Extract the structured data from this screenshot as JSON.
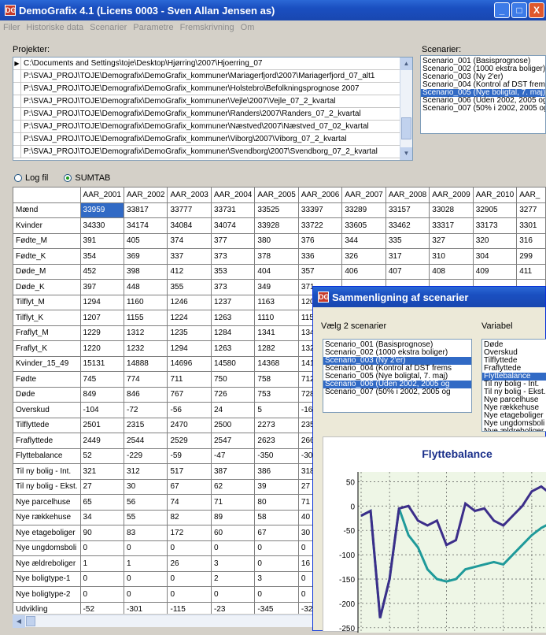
{
  "window": {
    "title": "DemoGrafix 4.1 (Licens 0003 - Sven Allan Jensen as)",
    "min": "_",
    "max": "□",
    "close": "X"
  },
  "menu": [
    "Filer",
    "Historiske data",
    "Scenarier",
    "Parametre",
    "Fremskrivning",
    "Om"
  ],
  "projects": {
    "label": "Projekter:",
    "items": [
      "C:\\Documents and Settings\\toje\\Desktop\\Hjørring\\2007\\Hjoerring_07",
      "P:\\SVAJ_PROJ\\TOJE\\Demografix\\DemoGrafix_kommuner\\Mariagerfjord\\2007\\Mariagerfjord_07_alt1",
      "P:\\SVAJ_PROJ\\TOJE\\Demografix\\DemoGrafix_kommuner\\Holstebro\\Befolkningsprognose 2007",
      "P:\\SVAJ_PROJ\\TOJE\\Demografix\\DemoGrafix_kommuner\\Vejle\\2007\\Vejle_07_2_kvartal",
      "P:\\SVAJ_PROJ\\TOJE\\Demografix\\DemoGrafix_kommuner\\Randers\\2007\\Randers_07_2_kvartal",
      "P:\\SVAJ_PROJ\\TOJE\\Demografix\\DemoGrafix_kommuner\\Næstved\\2007\\Næstved_07_02_kvartal",
      "P:\\SVAJ_PROJ\\TOJE\\Demografix\\DemoGrafix_kommuner\\Viborg\\2007\\Viborg_07_2_kvartal",
      "P:\\SVAJ_PROJ\\TOJE\\Demografix\\DemoGrafix_kommuner\\Svendborg\\2007\\Svendborg_07_2_kvartal"
    ]
  },
  "scenarios": {
    "label": "Scenarier:",
    "items": [
      "Scenario_001 (Basisprognose)",
      "Scenario_002 (1000 ekstra boliger)",
      "Scenario_003 (Ny 2'er)",
      "Scenario_004 (Kontrol af DST frems",
      "Scenario_005 (Nye boligtal, 7. maj)",
      "Scenario_006 (Uden 2002, 2005 og",
      "Scenario_007 (50% i 2002, 2005 og"
    ],
    "selected": 4
  },
  "view_options": {
    "logfil": "Log fil",
    "sumtab": "SUMTAB",
    "selected": "SUMTAB"
  },
  "table": {
    "columns": [
      "AAR_2001",
      "AAR_2002",
      "AAR_2003",
      "AAR_2004",
      "AAR_2005",
      "AAR_2006",
      "AAR_2007",
      "AAR_2008",
      "AAR_2009",
      "AAR_2010",
      "AAR_"
    ],
    "rows": [
      {
        "label": "Mænd",
        "values": [
          "33959",
          "33817",
          "33777",
          "33731",
          "33525",
          "33397",
          "33289",
          "33157",
          "33028",
          "32905",
          "3277"
        ]
      },
      {
        "label": "Kvinder",
        "values": [
          "34330",
          "34174",
          "34084",
          "34074",
          "33928",
          "33722",
          "33605",
          "33462",
          "33317",
          "33173",
          "3301"
        ]
      },
      {
        "label": "Fødte_M",
        "values": [
          "391",
          "405",
          "374",
          "377",
          "380",
          "376",
          "344",
          "335",
          "327",
          "320",
          "316"
        ]
      },
      {
        "label": "Fødte_K",
        "values": [
          "354",
          "369",
          "337",
          "373",
          "378",
          "336",
          "326",
          "317",
          "310",
          "304",
          "299"
        ]
      },
      {
        "label": "Døde_M",
        "values": [
          "452",
          "398",
          "412",
          "353",
          "404",
          "357",
          "406",
          "407",
          "408",
          "409",
          "411"
        ]
      },
      {
        "label": "Døde_K",
        "values": [
          "397",
          "448",
          "355",
          "373",
          "349",
          "371",
          "",
          "",
          "",
          "",
          ""
        ]
      },
      {
        "label": "Tilflyt_M",
        "values": [
          "1294",
          "1160",
          "1246",
          "1237",
          "1163",
          "1206",
          "",
          "",
          "",
          "",
          ""
        ]
      },
      {
        "label": "Tilflyt_K",
        "values": [
          "1207",
          "1155",
          "1224",
          "1263",
          "1110",
          "1151",
          "",
          "",
          "",
          "",
          ""
        ]
      },
      {
        "label": "Fraflyt_M",
        "values": [
          "1229",
          "1312",
          "1235",
          "1284",
          "1341",
          "1341",
          "",
          "",
          "",
          "",
          ""
        ]
      },
      {
        "label": "Fraflyt_K",
        "values": [
          "1220",
          "1232",
          "1294",
          "1263",
          "1282",
          "1322",
          "",
          "",
          "",
          "",
          ""
        ]
      },
      {
        "label": "Kvinder_15_49",
        "values": [
          "15131",
          "14888",
          "14696",
          "14580",
          "14368",
          "1415",
          "",
          "",
          "",
          "",
          ""
        ]
      },
      {
        "label": "Fødte",
        "values": [
          "745",
          "774",
          "711",
          "750",
          "758",
          "712",
          "",
          "",
          "",
          "",
          ""
        ]
      },
      {
        "label": "Døde",
        "values": [
          "849",
          "846",
          "767",
          "726",
          "753",
          "728",
          "",
          "",
          "",
          "",
          ""
        ]
      },
      {
        "label": "Overskud",
        "values": [
          "-104",
          "-72",
          "-56",
          "24",
          "5",
          "-16",
          "",
          "",
          "",
          "",
          ""
        ]
      },
      {
        "label": "Tilflyttede",
        "values": [
          "2501",
          "2315",
          "2470",
          "2500",
          "2273",
          "2357",
          "",
          "",
          "",
          "",
          ""
        ]
      },
      {
        "label": "Fraflyttede",
        "values": [
          "2449",
          "2544",
          "2529",
          "2547",
          "2623",
          "2663",
          "",
          "",
          "",
          "",
          ""
        ]
      },
      {
        "label": "Flyttebalance",
        "values": [
          "52",
          "-229",
          "-59",
          "-47",
          "-350",
          "-306",
          "",
          "",
          "",
          "",
          ""
        ]
      },
      {
        "label": "Til ny bolig - Int.",
        "values": [
          "321",
          "312",
          "517",
          "387",
          "386",
          "318",
          "",
          "",
          "",
          "",
          ""
        ]
      },
      {
        "label": "Til ny bolig - Ekst.",
        "values": [
          "27",
          "30",
          "67",
          "62",
          "39",
          "27",
          "",
          "",
          "",
          "",
          ""
        ]
      },
      {
        "label": "Nye parcelhuse",
        "values": [
          "65",
          "56",
          "74",
          "71",
          "80",
          "71",
          "",
          "",
          "",
          "",
          ""
        ]
      },
      {
        "label": "Nye rækkehuse",
        "values": [
          "34",
          "55",
          "82",
          "89",
          "58",
          "40",
          "",
          "",
          "",
          "",
          ""
        ]
      },
      {
        "label": "Nye etageboliger",
        "values": [
          "90",
          "83",
          "172",
          "60",
          "67",
          "30",
          "",
          "",
          "",
          "",
          ""
        ]
      },
      {
        "label": "Nye ungdomsboli",
        "values": [
          "0",
          "0",
          "0",
          "0",
          "0",
          "0",
          "",
          "",
          "",
          "",
          ""
        ]
      },
      {
        "label": "Nye ældreboliger",
        "values": [
          "1",
          "1",
          "26",
          "3",
          "0",
          "16",
          "",
          "",
          "",
          "",
          ""
        ]
      },
      {
        "label": "Nye boligtype-1",
        "values": [
          "0",
          "0",
          "0",
          "2",
          "3",
          "0",
          "",
          "",
          "",
          "",
          ""
        ]
      },
      {
        "label": "Nye boligtype-2",
        "values": [
          "0",
          "0",
          "0",
          "0",
          "0",
          "0",
          "",
          "",
          "",
          "",
          ""
        ]
      },
      {
        "label": "Udvikling",
        "values": [
          "-52",
          "-301",
          "-115",
          "-23",
          "-345",
          "-322",
          "",
          "",
          "",
          "",
          ""
        ]
      },
      {
        "label": "Folketal_ultimo",
        "values": [
          "68289",
          "67991",
          "67861",
          "67805",
          "67453",
          "6711",
          "",
          "",
          "",
          "",
          ""
        ]
      }
    ]
  },
  "dialog": {
    "title": "Sammenligning af scenarier",
    "choose_label": "Vælg 2 scenarier",
    "variable_label": "Variabel",
    "scenarios": [
      "Scenario_001 (Basisprognose)",
      "Scenario_002 (1000 ekstra boliger)",
      "Scenario_003 (Ny 2'er)",
      "Scenario_004 (Kontrol af DST frems",
      "Scenario_005 (Nye boligtal, 7. maj)",
      "Scenario_006 (Uden 2002, 2005 og",
      "Scenario_007 (50% i 2002, 2005 og"
    ],
    "selected_scenarios": [
      2,
      5
    ],
    "variables": [
      "Døde",
      "Overskud",
      "Tilflyttede",
      "Fraflyttede",
      "Flyttebalance",
      "Til ny bolig - Int.",
      "Til ny bolig - Ekst.",
      "Nye parcelhuse",
      "Nye rækkehuse",
      "Nye etageboliger",
      "Nye ungdomsboli",
      "Nye ældreboliger"
    ],
    "selected_variable": 4
  },
  "colors": {
    "series_a": "#3c2e8a",
    "series_b": "#1f9a9a",
    "selection": "#316ac5"
  },
  "chart_data": {
    "type": "line",
    "title": "Flyttebalance",
    "xlabel": "",
    "ylabel": "",
    "ylim": [
      -260,
      70
    ],
    "yticks": [
      50,
      0,
      -50,
      -100,
      -150,
      -200,
      -250
    ],
    "grid": true,
    "x": [
      1,
      2,
      3,
      4,
      5,
      6,
      7,
      8,
      9,
      10,
      11,
      12,
      13,
      14,
      15,
      16,
      17,
      18,
      19,
      20,
      21
    ],
    "series": [
      {
        "values": [
          -20,
          -10,
          -230,
          -150,
          -5,
          0,
          -30,
          -40,
          -30,
          -80,
          -70,
          5,
          -10,
          -5,
          -30,
          -40,
          -20,
          0,
          30,
          40,
          25
        ]
      },
      {
        "values": [
          -20,
          -10,
          -230,
          -150,
          -5,
          -60,
          -85,
          -130,
          -150,
          -155,
          -150,
          -130,
          -125,
          -120,
          -115,
          -120,
          -100,
          -80,
          -60,
          -45,
          -35
        ]
      }
    ]
  }
}
